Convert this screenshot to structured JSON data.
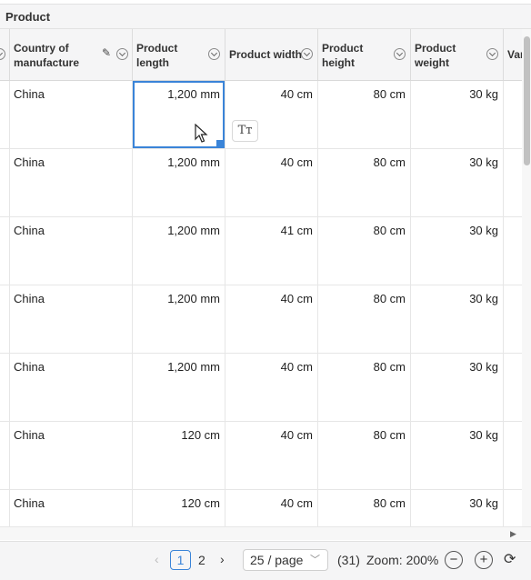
{
  "group": {
    "title": "Product"
  },
  "columns": [
    {
      "id": "country",
      "line1": "Country of",
      "line2": "manufacture",
      "align": "text",
      "pin_icon": "pin-icon"
    },
    {
      "id": "length",
      "line1": "Product",
      "line2": "length",
      "align": "num"
    },
    {
      "id": "width",
      "line1": "Product width",
      "line2": "",
      "align": "num"
    },
    {
      "id": "height",
      "line1": "Product",
      "line2": "height",
      "align": "num"
    },
    {
      "id": "weight",
      "line1": "Product",
      "line2": "weight",
      "align": "num"
    },
    {
      "id": "partial",
      "line1": "Var",
      "line2": "",
      "align": "num"
    }
  ],
  "rows": [
    [
      "China",
      "1,200 mm",
      "40 cm",
      "80 cm",
      "30 kg"
    ],
    [
      "China",
      "1,200 mm",
      "40 cm",
      "80 cm",
      "30 kg"
    ],
    [
      "China",
      "1,200 mm",
      "41 cm",
      "80 cm",
      "30 kg"
    ],
    [
      "China",
      "1,200 mm",
      "40 cm",
      "80 cm",
      "30 kg"
    ],
    [
      "China",
      "1,200 mm",
      "40 cm",
      "80 cm",
      "30 kg"
    ],
    [
      "China",
      "120 cm",
      "40 cm",
      "80 cm",
      "30 kg"
    ],
    [
      "China",
      "120 cm",
      "40 cm",
      "80 cm",
      "30 kg"
    ]
  ],
  "selected": {
    "row": 0,
    "column": "length"
  },
  "cell_tool": {
    "label": "Tт",
    "icon": "text-format-icon"
  },
  "pagination": {
    "prev": "‹",
    "pages": [
      "1",
      "2"
    ],
    "current": "1",
    "next": "›",
    "page_size": "25 / page",
    "total": "(31)",
    "zoom": "Zoom: 200%",
    "zoom_out": "−",
    "zoom_in": "+",
    "refresh_icon": "refresh-icon"
  },
  "colors": {
    "accent": "#3a84d8",
    "header_bg": "#f5f5f6",
    "border": "#e6e6e6"
  }
}
